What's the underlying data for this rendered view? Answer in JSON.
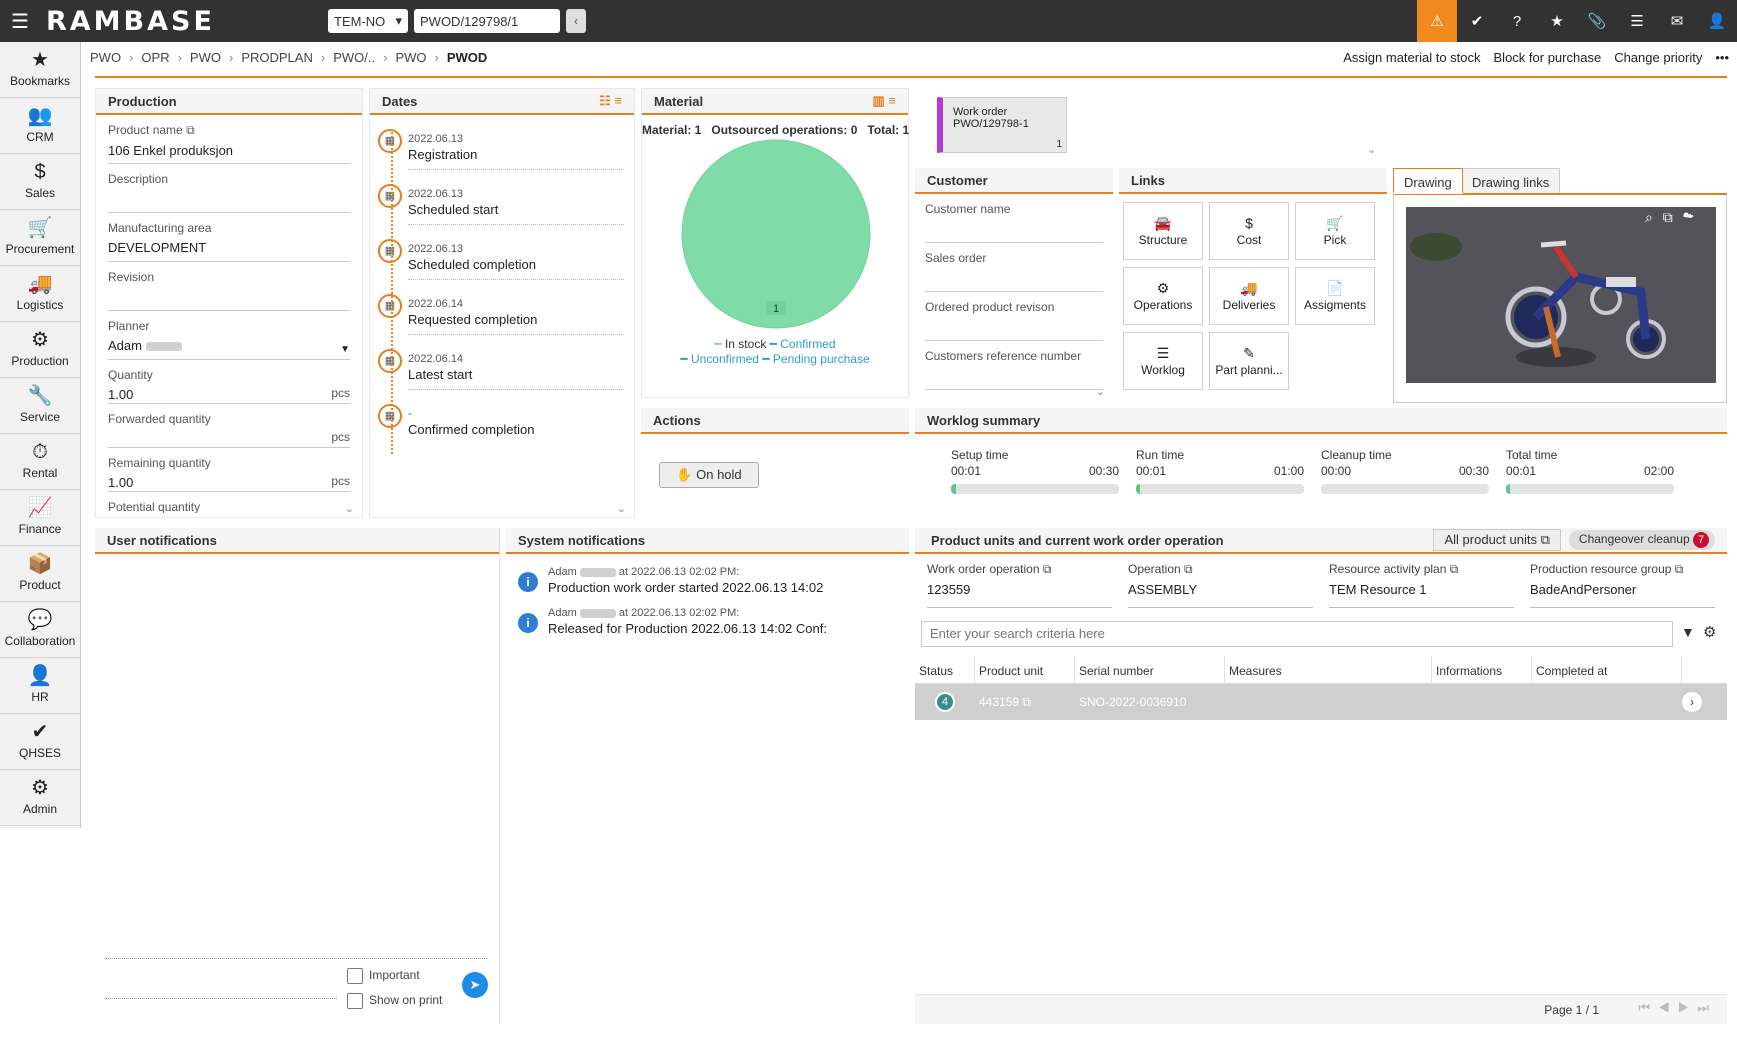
{
  "app": {
    "logo": "RAMBASE",
    "company": "TEM-NO",
    "doc_input": "PWOD/129798/1"
  },
  "sidebar": [
    {
      "label": "Bookmarks",
      "icon": "★"
    },
    {
      "label": "CRM",
      "icon": "👥"
    },
    {
      "label": "Sales",
      "icon": "$"
    },
    {
      "label": "Procurement",
      "icon": "🛒"
    },
    {
      "label": "Logistics",
      "icon": "🚚"
    },
    {
      "label": "Production",
      "icon": "⚙"
    },
    {
      "label": "Service",
      "icon": "🔧"
    },
    {
      "label": "Rental",
      "icon": "⏱"
    },
    {
      "label": "Finance",
      "icon": "📈"
    },
    {
      "label": "Product",
      "icon": "📦"
    },
    {
      "label": "Collaboration",
      "icon": "💬"
    },
    {
      "label": "HR",
      "icon": "👤"
    },
    {
      "label": "QHSES",
      "icon": "✔"
    },
    {
      "label": "Admin",
      "icon": "⚙"
    }
  ],
  "breadcrumbs": [
    "PWO",
    "OPR",
    "PWO",
    "PRODPLAN",
    "PWO/..",
    "PWO",
    "PWOD"
  ],
  "top_actions": [
    "Assign material to stock",
    "Block for purchase",
    "Change priority",
    "•••"
  ],
  "production": {
    "title": "Production",
    "fields": [
      {
        "label": "Product name",
        "value": "106 Enkel produksjon"
      },
      {
        "label": "Description",
        "value": ""
      },
      {
        "label": "Manufacturing area",
        "value": "DEVELOPMENT"
      },
      {
        "label": "Revision",
        "value": ""
      },
      {
        "label": "Planner",
        "value": "Adam"
      },
      {
        "label": "Quantity",
        "value": "1.00",
        "unit": "pcs"
      },
      {
        "label": "Forwarded quantity",
        "value": "",
        "unit": "pcs"
      },
      {
        "label": "Remaining quantity",
        "value": "1.00",
        "unit": "pcs"
      },
      {
        "label": "Potential quantity",
        "value": ""
      }
    ]
  },
  "dates": {
    "title": "Dates",
    "items": [
      {
        "date": "2022.06.13",
        "label": "Registration"
      },
      {
        "date": "2022.06.13",
        "label": "Scheduled start"
      },
      {
        "date": "2022.06.13",
        "label": "Scheduled completion"
      },
      {
        "date": "2022.06.14",
        "label": "Requested completion"
      },
      {
        "date": "2022.06.14",
        "label": "Latest start"
      },
      {
        "date": "-",
        "label": "Confirmed completion"
      }
    ]
  },
  "material": {
    "title": "Material",
    "summary": "Material: 1   Outsourced operations: 0   Total: 1",
    "slice_value": "1",
    "legend": [
      "In stock",
      "Confirmed",
      "Unconfirmed",
      "Pending purchase"
    ],
    "colors": {
      "in_stock": "#7fdca8",
      "confirmed": "#2e9ec9",
      "unconfirmed": "#2e9ec9",
      "pending": "#2e9ec9"
    }
  },
  "workorder_card": {
    "line1": "Work order",
    "line2": "PWO/129798-1",
    "count": "1"
  },
  "customer": {
    "title": "Customer",
    "fields": [
      "Customer name",
      "Sales order",
      "Ordered product revison",
      "Customers reference number"
    ]
  },
  "links": {
    "title": "Links",
    "buttons": [
      {
        "label": "Structure",
        "icon": "🚘"
      },
      {
        "label": "Cost",
        "icon": "$"
      },
      {
        "label": "Pick",
        "icon": "🛒"
      },
      {
        "label": "Operations",
        "icon": "⚙"
      },
      {
        "label": "Deliveries",
        "icon": "🚚"
      },
      {
        "label": "Assigments",
        "icon": "📄"
      },
      {
        "label": "Worklog",
        "icon": "☰"
      },
      {
        "label": "Part planni...",
        "icon": "✎"
      }
    ]
  },
  "drawing": {
    "tabs": [
      "Drawing",
      "Drawing links"
    ]
  },
  "actions": {
    "title": "Actions",
    "on_hold": "On hold"
  },
  "worklog": {
    "title": "Worklog summary",
    "items": [
      {
        "label": "Setup time",
        "start": "00:01",
        "end": "00:30",
        "progress": 0.03
      },
      {
        "label": "Run time",
        "start": "00:01",
        "end": "01:00",
        "progress": 0.02
      },
      {
        "label": "Cleanup time",
        "start": "00:00",
        "end": "00:30",
        "progress": 0
      },
      {
        "label": "Total time",
        "start": "00:01",
        "end": "02:00",
        "progress": 0.01
      }
    ]
  },
  "user_notifications": {
    "title": "User notifications",
    "important": "Important",
    "show_on_print": "Show on print"
  },
  "system_notifications": {
    "title": "System notifications",
    "items": [
      {
        "user": "Adam",
        "meta": "at 2022.06.13 02:02 PM:",
        "text": "Production work order started 2022.06.13 14:02"
      },
      {
        "user": "Adam",
        "meta": "at 2022.06.13 02:02 PM:",
        "text": "Released for Production 2022.06.13 14:02 Conf:"
      }
    ]
  },
  "product_units": {
    "title": "Product units and current work order operation",
    "all_units": "All product units",
    "changeover": "Changeover cleanup",
    "changeover_count": "7",
    "info": [
      {
        "label": "Work order operation",
        "value": "123559"
      },
      {
        "label": "Operation",
        "value": "ASSEMBLY"
      },
      {
        "label": "Resource activity plan",
        "value": "TEM Resource 1"
      },
      {
        "label": "Production resource group",
        "value": "BadeAndPersoner"
      }
    ],
    "search_placeholder": "Enter your search criteria here",
    "columns": [
      "Status",
      "Product unit",
      "Serial number",
      "Measures",
      "Informations",
      "Completed at"
    ],
    "row": {
      "status": "4",
      "unit": "443159",
      "serial": "SNO-2022-0036910",
      "measures": "",
      "info": "",
      "completed": ""
    },
    "page": "Page 1 / 1"
  }
}
